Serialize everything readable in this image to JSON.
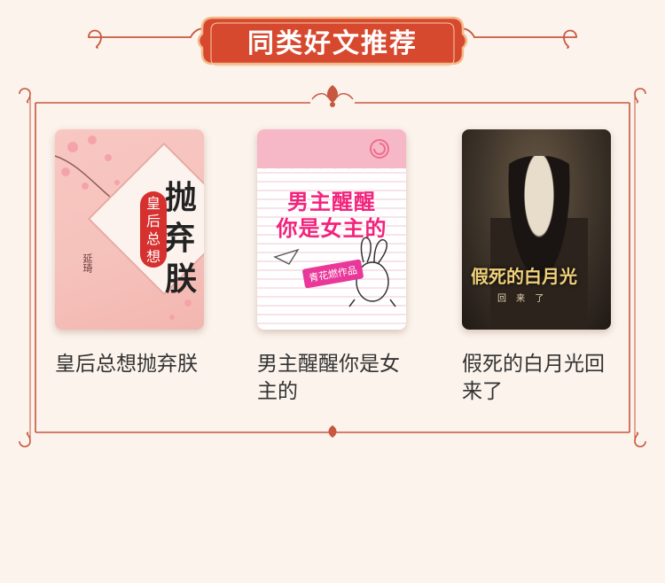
{
  "header": {
    "title": "同类好文推荐"
  },
  "books": [
    {
      "title": "皇后总想抛弃朕",
      "cover": {
        "big_chars": [
          "抛",
          "弃",
          "朕"
        ],
        "red_pill": "皇后总想",
        "author": "延琦"
      }
    },
    {
      "title": "男主醒醒你是女主的",
      "cover": {
        "line1": "男主醒醒",
        "line2": "你是女主的",
        "tag": "青花燃作品"
      }
    },
    {
      "title": "假死的白月光回来了",
      "cover": {
        "main": "假死的白月光",
        "sub": "回 来 了"
      }
    }
  ],
  "colors": {
    "accent": "#d7492f",
    "banner_border": "#f3b98a",
    "background": "#fbf3ec"
  }
}
